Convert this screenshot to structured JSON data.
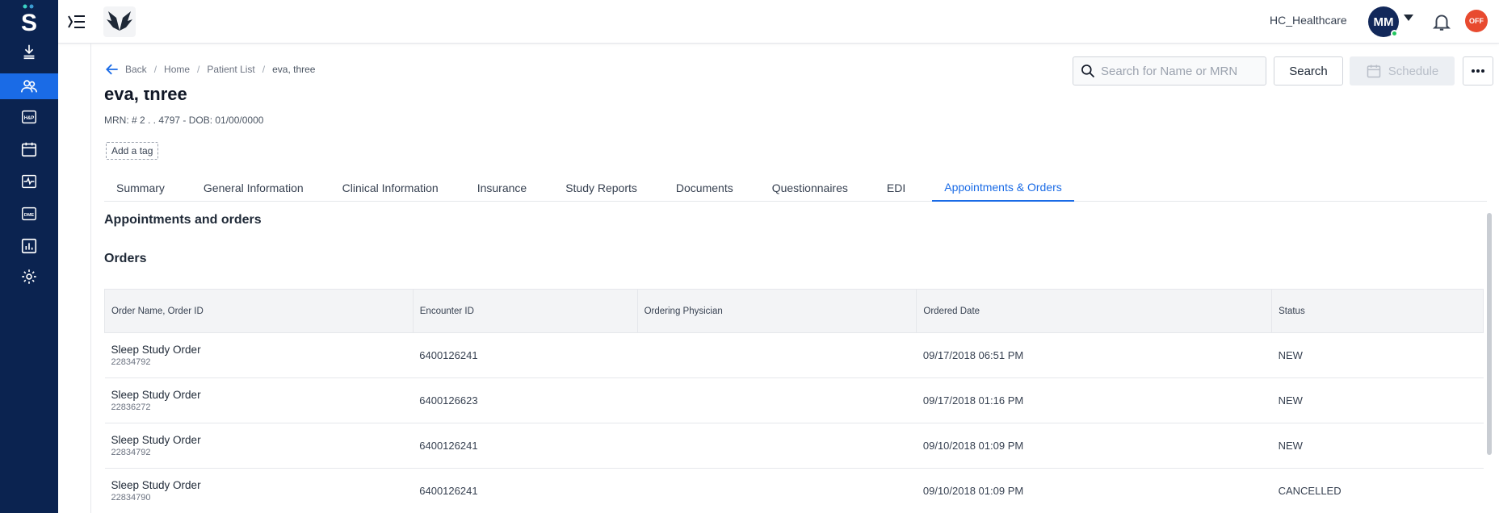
{
  "header": {
    "org_name": "HC_Healthcare",
    "avatar_initials": "MM",
    "off_badge": "OFF"
  },
  "sidebar": {
    "logo": "S",
    "items": [
      {
        "name": "download-icon"
      },
      {
        "name": "patients-icon",
        "active": true
      },
      {
        "name": "hp-icon",
        "label": "H&P"
      },
      {
        "name": "calendar-icon"
      },
      {
        "name": "activity-icon"
      },
      {
        "name": "dme-icon",
        "label": "DME"
      },
      {
        "name": "bar-chart-icon"
      },
      {
        "name": "gear-icon"
      }
    ]
  },
  "breadcrumb": {
    "back": "Back",
    "home": "Home",
    "patient_list": "Patient List",
    "current": "eva, three"
  },
  "search": {
    "placeholder": "Search for Name or MRN",
    "button": "Search",
    "schedule": "Schedule"
  },
  "patient": {
    "name": "eva, three",
    "meta": "MRN: # 2 . . 4797 - DOB: 01/00/0000",
    "add_tag": "Add a tag"
  },
  "tabs": [
    {
      "label": "Summary"
    },
    {
      "label": "General Information"
    },
    {
      "label": "Clinical Information"
    },
    {
      "label": "Insurance"
    },
    {
      "label": "Study Reports"
    },
    {
      "label": "Documents"
    },
    {
      "label": "Questionnaires"
    },
    {
      "label": "EDI"
    },
    {
      "label": "Appointments & Orders",
      "active": true
    }
  ],
  "section_title": "Appointments and orders",
  "orders": {
    "title": "Orders",
    "columns": [
      "Order Name, Order ID",
      "Encounter ID",
      "Ordering Physician",
      "Ordered Date",
      "Status"
    ],
    "rows": [
      {
        "order_name": "Sleep Study Order",
        "order_id": "22834792",
        "encounter_id": "6400126241",
        "physician": "",
        "date": "09/17/2018 06:51 PM",
        "status": "NEW"
      },
      {
        "order_name": "Sleep Study Order",
        "order_id": "22836272",
        "encounter_id": "6400126623",
        "physician": "",
        "date": "09/17/2018 01:16 PM",
        "status": "NEW"
      },
      {
        "order_name": "Sleep Study Order",
        "order_id": "22834792",
        "encounter_id": "6400126241",
        "physician": "",
        "date": "09/10/2018 01:09 PM",
        "status": "NEW"
      },
      {
        "order_name": "Sleep Study Order",
        "order_id": "22834790",
        "encounter_id": "6400126241",
        "physician": "",
        "date": "09/10/2018 01:09 PM",
        "status": "CANCELLED"
      }
    ]
  },
  "colors": {
    "sidebar_bg": "#0b2350",
    "accent": "#1a6be6",
    "off_badge": "#e84a2f"
  }
}
